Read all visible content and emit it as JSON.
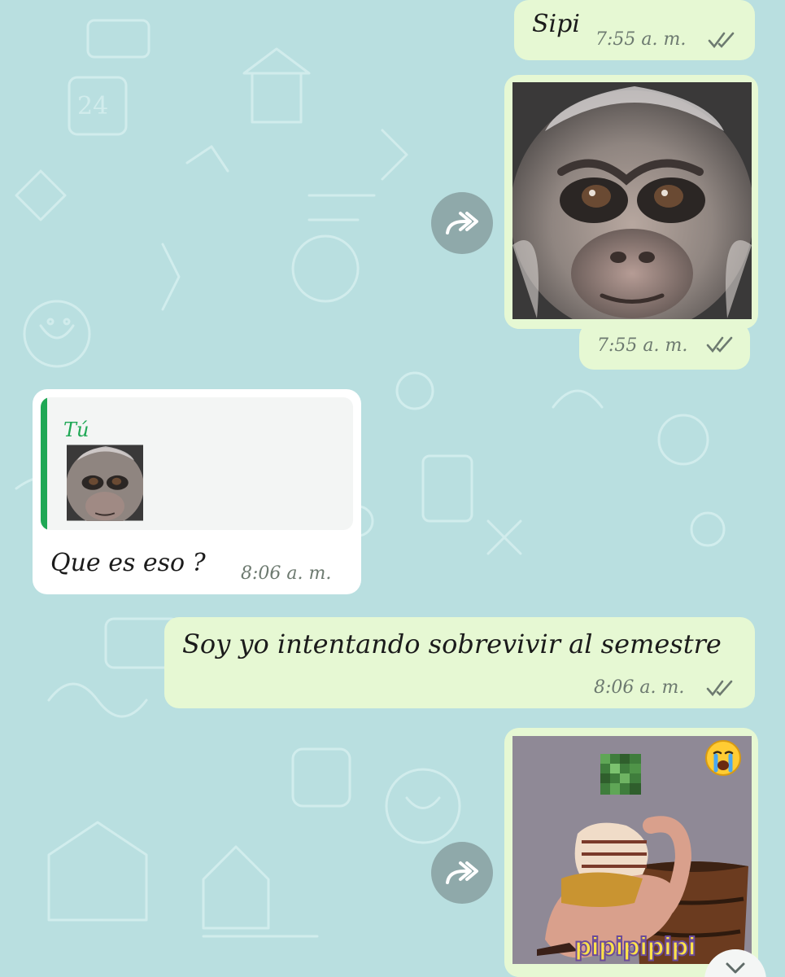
{
  "colors": {
    "wallpaper": "#b9dfe0",
    "outgoing_bubble": "#e6f8d3",
    "incoming_bubble": "#ffffff",
    "quote_accent": "#1fa855",
    "read_ticks": "#6d7a70"
  },
  "messages": [
    {
      "direction": "outgoing",
      "text": "Sipi",
      "time": "7:55 a. m.",
      "status": "read-ticks-icon"
    },
    {
      "direction": "outgoing",
      "media": "monkey-face-photo",
      "forward_icon": "forward-arrow-icon",
      "time": "7:55 a. m.",
      "status": "read-ticks-icon"
    },
    {
      "direction": "incoming",
      "quote": {
        "author": "Tú",
        "media": "monkey-face-thumbnail"
      },
      "text": "Que es eso ?",
      "time": "8:06 a. m."
    },
    {
      "direction": "outgoing",
      "text": "Soy yo intentando sobrevivir al semestre",
      "time": "8:06 a. m.",
      "status": "read-ticks-icon"
    },
    {
      "direction": "outgoing",
      "media": "cartoon-sticker",
      "forward_icon": "forward-arrow-icon",
      "sticker": {
        "caption": "pipipipipi",
        "emoji": "crying-face-icon"
      }
    }
  ],
  "scroll_down_icon": "chevron-down-icon"
}
